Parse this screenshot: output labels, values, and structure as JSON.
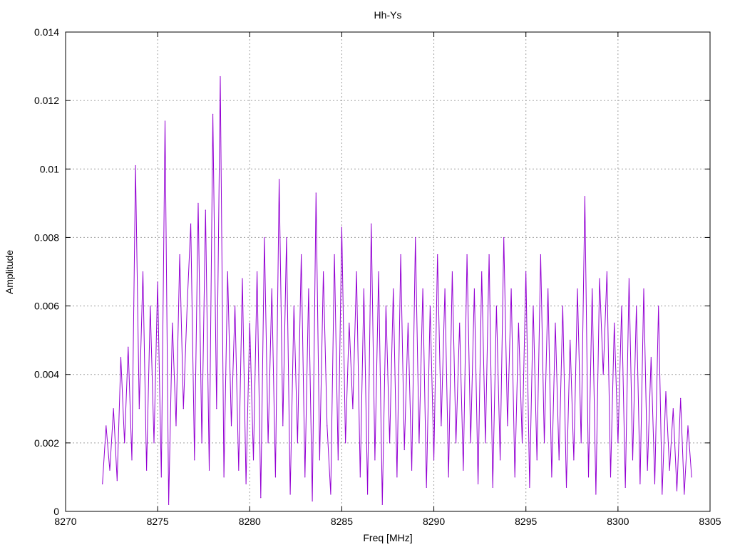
{
  "chart_data": {
    "type": "line",
    "title": "Hh-Ys",
    "xlabel": "Freq [MHz]",
    "ylabel": "Amplitude",
    "xlim": [
      8270,
      8305
    ],
    "ylim": [
      0,
      0.014
    ],
    "xticks": [
      "8270",
      "8275",
      "8280",
      "8285",
      "8290",
      "8295",
      "8300",
      "8305"
    ],
    "yticks": [
      "0",
      "0.002",
      "0.004",
      "0.006",
      "0.008",
      "0.01",
      "0.012",
      "0.014"
    ],
    "grid": true,
    "series": [
      {
        "name": "Hh-Ys",
        "color": "#9400d3",
        "x_start": 8272.0,
        "x_step": 0.2,
        "values": [
          0.0008,
          0.0025,
          0.0012,
          0.003,
          0.0009,
          0.0045,
          0.002,
          0.0048,
          0.0015,
          0.0101,
          0.003,
          0.007,
          0.0012,
          0.006,
          0.002,
          0.0067,
          0.001,
          0.0114,
          0.0002,
          0.0055,
          0.0025,
          0.0075,
          0.003,
          0.006,
          0.0084,
          0.0015,
          0.009,
          0.002,
          0.0088,
          0.0012,
          0.0116,
          0.003,
          0.0127,
          0.001,
          0.007,
          0.0025,
          0.006,
          0.0012,
          0.0068,
          0.0008,
          0.0055,
          0.0015,
          0.007,
          0.0004,
          0.008,
          0.002,
          0.0065,
          0.001,
          0.0097,
          0.0025,
          0.008,
          0.0005,
          0.006,
          0.002,
          0.0075,
          0.001,
          0.0065,
          0.0003,
          0.0093,
          0.0015,
          0.007,
          0.0025,
          0.0005,
          0.0075,
          0.0015,
          0.0083,
          0.002,
          0.0055,
          0.003,
          0.007,
          0.001,
          0.0065,
          0.0005,
          0.0084,
          0.0015,
          0.007,
          0.0002,
          0.006,
          0.002,
          0.0065,
          0.001,
          0.0075,
          0.0018,
          0.0055,
          0.0012,
          0.008,
          0.002,
          0.0065,
          0.0007,
          0.006,
          0.0015,
          0.0075,
          0.0025,
          0.0065,
          0.001,
          0.007,
          0.002,
          0.0055,
          0.0012,
          0.0075,
          0.002,
          0.0065,
          0.0008,
          0.007,
          0.002,
          0.0075,
          0.0007,
          0.006,
          0.0015,
          0.008,
          0.0025,
          0.0065,
          0.001,
          0.0055,
          0.002,
          0.007,
          0.0007,
          0.006,
          0.0015,
          0.0075,
          0.002,
          0.0065,
          0.001,
          0.0055,
          0.0015,
          0.006,
          0.0007,
          0.005,
          0.0015,
          0.0065,
          0.002,
          0.0092,
          0.001,
          0.0065,
          0.0005,
          0.0068,
          0.004,
          0.007,
          0.001,
          0.0055,
          0.002,
          0.006,
          0.0007,
          0.0068,
          0.0015,
          0.006,
          0.0008,
          0.0065,
          0.0012,
          0.0045,
          0.0008,
          0.006,
          0.0005,
          0.0035,
          0.0012,
          0.003,
          0.0006,
          0.0033,
          0.0005,
          0.0025,
          0.001
        ]
      }
    ]
  }
}
